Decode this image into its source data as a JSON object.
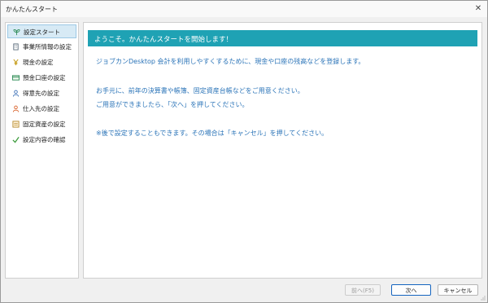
{
  "window": {
    "title": "かんたんスタート",
    "close_glyph": "✕"
  },
  "sidebar": {
    "items": [
      {
        "label": "設定スタート",
        "icon": "sprout-icon",
        "color": "#2e8b57"
      },
      {
        "label": "事業所情報の設定",
        "icon": "building-icon",
        "color": "#5a6b7b"
      },
      {
        "label": "現金の設定",
        "icon": "yen-icon",
        "color": "#c9a227"
      },
      {
        "label": "預金口座の設定",
        "icon": "bankbook-icon",
        "color": "#2e8b57"
      },
      {
        "label": "得意先の設定",
        "icon": "customer-icon",
        "color": "#3b6fb6"
      },
      {
        "label": "仕入先の設定",
        "icon": "supplier-icon",
        "color": "#d9622b"
      },
      {
        "label": "固定資産の設定",
        "icon": "asset-icon",
        "color": "#b5882c"
      },
      {
        "label": "設定内容の確認",
        "icon": "checkmark-icon",
        "color": "#3a9a3a"
      }
    ]
  },
  "main": {
    "banner": "ようこそ。かんたんスタートを開始します！",
    "lines": [
      "ジョブカンDesktop 会計を利用しやすくするために、現金や口座の残高などを登録します。",
      "お手元に、前年の決算書や帳簿、固定資産台帳などをご用意ください。",
      "ご用意ができましたら、「次へ」を押してください。",
      "※後で設定することもできます。その場合は「キャンセル」を押してください。"
    ]
  },
  "footer": {
    "back_label": "前へ(F5)",
    "next_label": "次へ",
    "cancel_label": "キャンセル"
  },
  "colors": {
    "accent": "#1fa2b4",
    "text_blue": "#2b74b8",
    "selected_bg": "#d7eaf5"
  }
}
